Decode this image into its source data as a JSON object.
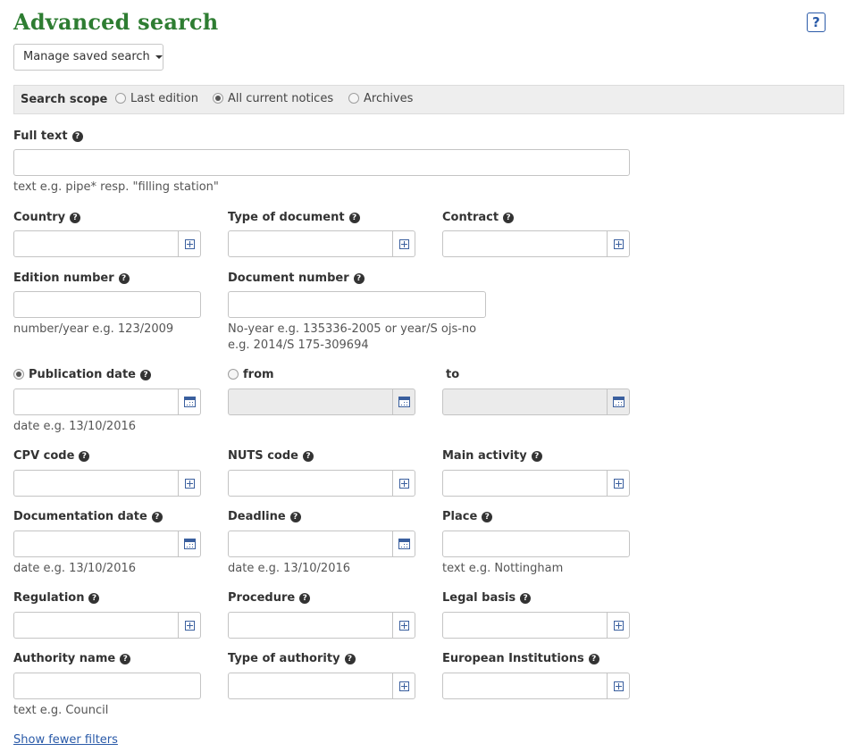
{
  "header": {
    "title": "Advanced search",
    "help_label": "?"
  },
  "saved_search": {
    "label": "Manage saved search"
  },
  "scope": {
    "label": "Search scope",
    "options": [
      "Last edition",
      "All current notices",
      "Archives"
    ],
    "selected": "All current notices"
  },
  "fields": {
    "full_text": {
      "label": "Full text",
      "hint": "text e.g. pipe* resp. \"filling station\""
    },
    "country": {
      "label": "Country"
    },
    "type_of_document": {
      "label": "Type of document"
    },
    "contract": {
      "label": "Contract"
    },
    "edition_number": {
      "label": "Edition number",
      "hint": "number/year e.g. 123/2009"
    },
    "document_number": {
      "label": "Document number",
      "hint_line1": "No-year e.g. 135336-2005 or year/S ojs-no",
      "hint_line2": "e.g. 2014/S 175-309694"
    },
    "publication_date": {
      "label": "Publication date",
      "hint": "date e.g. 13/10/2016"
    },
    "from": {
      "label": "from"
    },
    "to": {
      "label": "to"
    },
    "cpv_code": {
      "label": "CPV code"
    },
    "nuts_code": {
      "label": "NUTS code"
    },
    "main_activity": {
      "label": "Main activity"
    },
    "documentation_date": {
      "label": "Documentation date",
      "hint": "date e.g. 13/10/2016"
    },
    "deadline": {
      "label": "Deadline",
      "hint": "date e.g. 13/10/2016"
    },
    "place": {
      "label": "Place",
      "hint": "text e.g. Nottingham"
    },
    "regulation": {
      "label": "Regulation"
    },
    "procedure": {
      "label": "Procedure"
    },
    "legal_basis": {
      "label": "Legal basis"
    },
    "authority_name": {
      "label": "Authority name",
      "hint": "text e.g. Council"
    },
    "type_of_authority": {
      "label": "Type of authority"
    },
    "european_institutions": {
      "label": "European Institutions"
    }
  },
  "help_glyph": "?",
  "footer": {
    "link": "Show fewer filters"
  },
  "colors": {
    "title": "#2e7d32",
    "link": "#2a5aa8",
    "scope_bg": "#eeeeee"
  }
}
